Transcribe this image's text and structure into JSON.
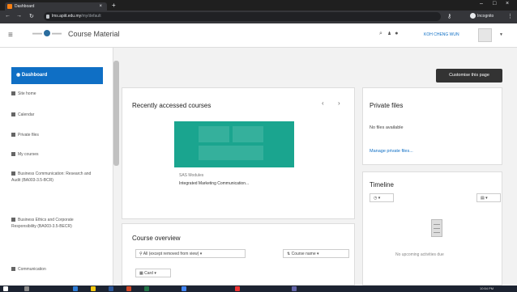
{
  "browser": {
    "tab_title": "Dashboard",
    "tab_close": "×",
    "new_tab": "+",
    "url_host": "lms.apiit.edu.my",
    "url_path": "/my/default",
    "incognito_label": "Incognito",
    "window_controls": [
      "–",
      "□",
      "×"
    ]
  },
  "navbar": {
    "site_title": "Course Material",
    "user_name": "KOH CHENG WUN",
    "menu_icon": "hamburger-icon"
  },
  "sidebar": {
    "active_item": "Dashboard",
    "items": [
      {
        "label": "Site home",
        "icon": "home-icon"
      },
      {
        "label": "Calendar",
        "icon": "calendar-icon"
      },
      {
        "label": "Private files",
        "icon": "file-icon"
      },
      {
        "label": "My courses",
        "icon": "graduation-cap-icon"
      },
      {
        "label": "Business Communication: Research and Audit (BA003-3.5-BCR)",
        "icon": "graduation-cap-icon"
      },
      {
        "label": "Business Ethics and Corporate Responsibility (BA003-3.5-BECR)",
        "icon": "graduation-cap-icon"
      },
      {
        "label": "Communication",
        "icon": "graduation-cap-icon"
      }
    ]
  },
  "main": {
    "customise_button": "Customise this page",
    "recent": {
      "title": "Recently accessed courses",
      "prev": "‹",
      "next": "›",
      "course_category": "SAS Modules",
      "course_name": "Integrated Marketing Communication..."
    },
    "overview": {
      "title": "Course overview",
      "filter_select": "All (except removed from view)",
      "sort_select": "Course name",
      "view_select": "Card"
    },
    "private_files": {
      "title": "Private files",
      "empty_text": "No files available",
      "manage_link": "Manage private files..."
    },
    "timeline": {
      "title": "Timeline",
      "empty_text": "No upcoming activities due"
    }
  },
  "taskbar": {
    "time": "10:54 PM"
  }
}
